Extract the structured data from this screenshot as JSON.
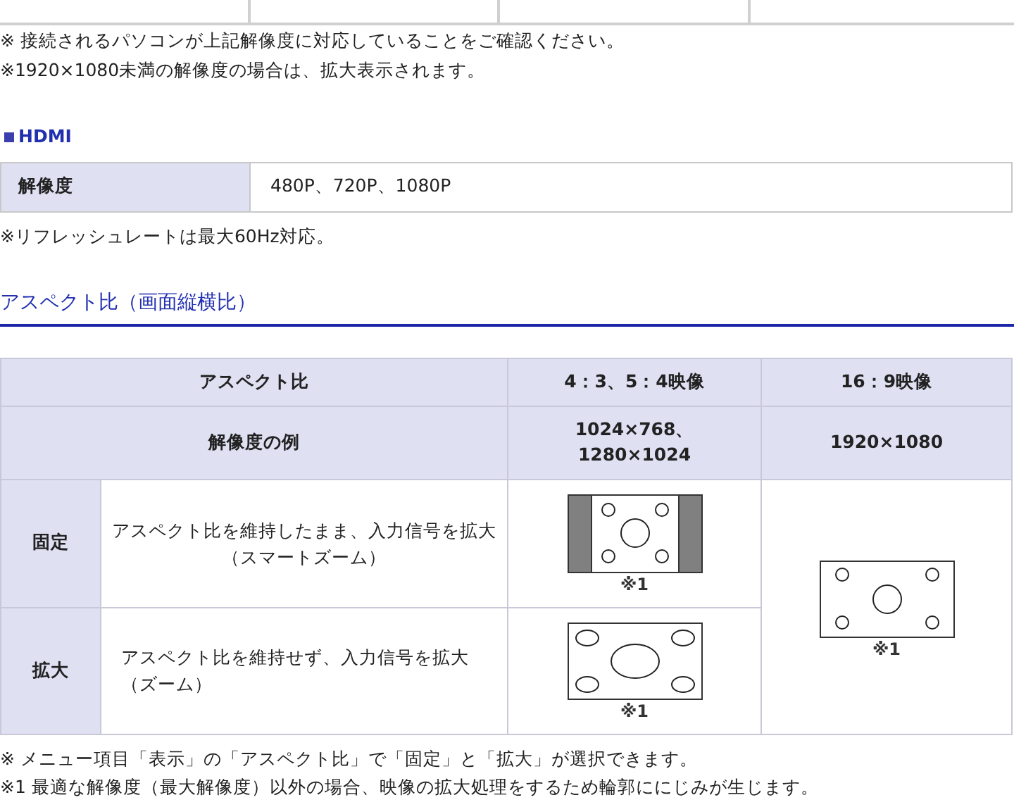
{
  "notes_top": [
    "※ 接続されるパソコンが上記解像度に対応していることをご確認ください。",
    "※1920×1080未満の解像度の場合は、拡大表示されます。"
  ],
  "hdmi": {
    "heading": "HDMI",
    "rows": [
      {
        "label": "解像度",
        "value": "480P、720P、1080P"
      }
    ],
    "note": "※リフレッシュレートは最大60Hz対応。"
  },
  "aspect": {
    "heading": "アスペクト比（画面縦横比）",
    "header_rows": [
      {
        "label": "アスペクト比",
        "col_1": [
          "4：3、5：4映像"
        ],
        "col_2": "16：9映像"
      },
      {
        "label": "解像度の例",
        "col_1": [
          "1024×768、",
          "1280×1024"
        ],
        "col_2": "1920×1080"
      }
    ],
    "rows": [
      {
        "mode": "固定",
        "kind": "centered",
        "description": [
          "アスペクト比を維持したまま、入力信号を拡大",
          "（スマートズーム）"
        ],
        "diagram": {
          "kind": "pillarbox",
          "note": "※1"
        }
      },
      {
        "mode": "拡大",
        "kind": "indented",
        "description": [
          "アスペクト比を維持せず、入力信号を拡大",
          "（ズーム）"
        ],
        "diagram": {
          "kind": "stretched",
          "note": "※1"
        }
      }
    ],
    "wide_diagram": {
      "kind": "full",
      "note": "※1"
    }
  },
  "notes_bottom": [
    "※ メニュー項目「表示」の「アスペクト比」で「固定」と「拡大」が選択できます。",
    "※1 最適な解像度（最大解像度）以外の場合、映像の拡大処理をするため輪郭ににじみが生じます。"
  ]
}
